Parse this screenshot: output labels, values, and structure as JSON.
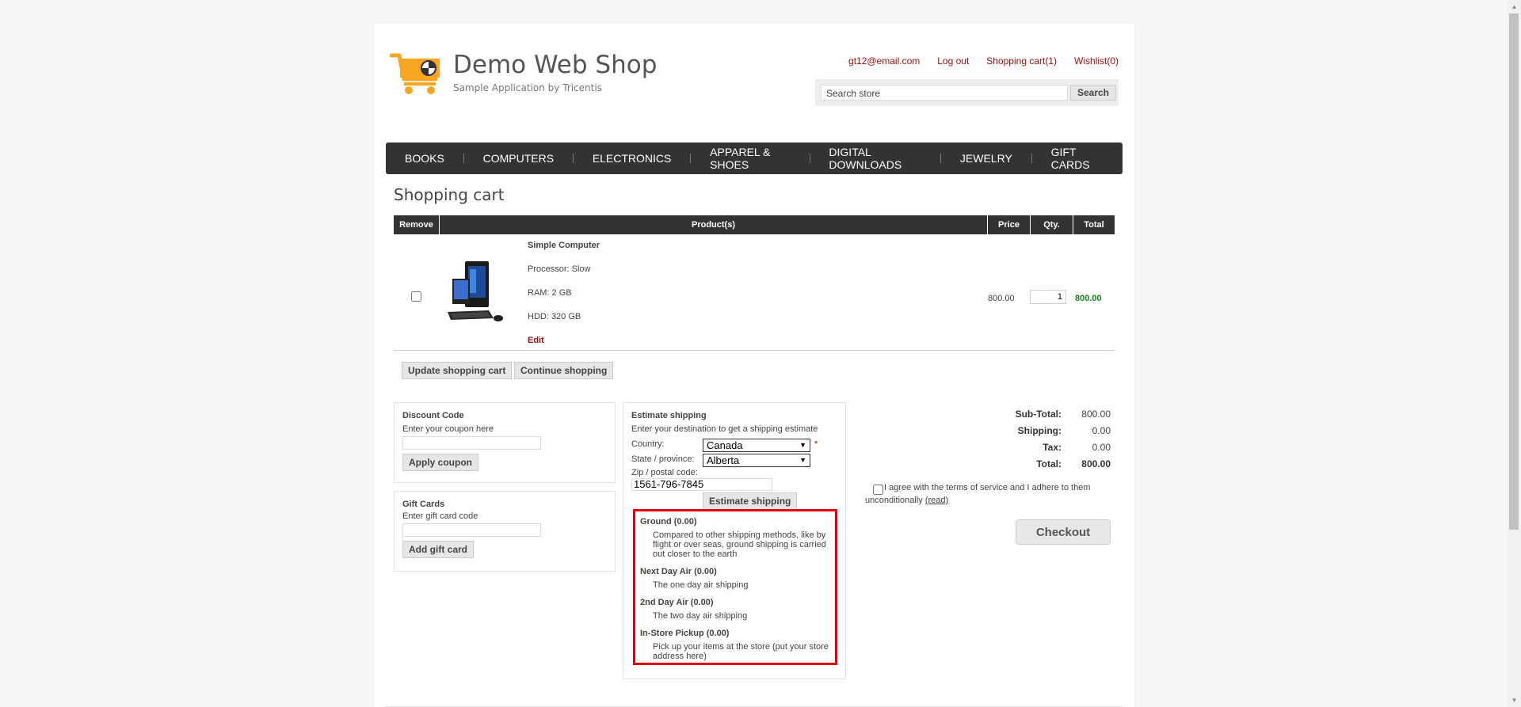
{
  "header": {
    "title": "Demo Web Shop",
    "subtitle": "Sample Application by Tricentis",
    "links": {
      "account": "gt12@email.com",
      "logout": "Log out",
      "cart": "Shopping cart(1)",
      "wishlist": "Wishlist(0)"
    },
    "search": {
      "value": "Search store",
      "button": "Search"
    }
  },
  "menu": [
    "BOOKS",
    "COMPUTERS",
    "ELECTRONICS",
    "APPAREL & SHOES",
    "DIGITAL DOWNLOADS",
    "JEWELRY",
    "GIFT CARDS"
  ],
  "page_title": "Shopping cart",
  "cart": {
    "columns": {
      "remove": "Remove",
      "product": "Product(s)",
      "price": "Price",
      "qty": "Qty.",
      "total": "Total"
    },
    "item": {
      "name": "Simple Computer",
      "attributes": [
        "Processor: Slow",
        "RAM: 2 GB",
        "HDD: 320 GB"
      ],
      "edit": "Edit",
      "price": "800.00",
      "qty": "1",
      "total": "800.00",
      "remove_checked": false
    },
    "buttons": {
      "update": "Update shopping cart",
      "continue": "Continue shopping"
    }
  },
  "discount": {
    "title": "Discount Code",
    "hint": "Enter your coupon here",
    "button": "Apply coupon"
  },
  "giftcard": {
    "title": "Gift Cards",
    "hint": "Enter gift card code",
    "button": "Add gift card"
  },
  "estimate": {
    "title": "Estimate shipping",
    "hint": "Enter your destination to get a shipping estimate",
    "country_label": "Country:",
    "country_value": "Canada",
    "state_label": "State / province:",
    "state_value": "Alberta",
    "zip_label": "Zip / postal code:",
    "zip_value": "1561-796-7845",
    "button": "Estimate shipping",
    "required_mark": "*",
    "options": [
      {
        "name": "Ground (0.00)",
        "desc": "Compared to other shipping methods, like by flight or over seas, ground shipping is carried out closer to the earth"
      },
      {
        "name": "Next Day Air (0.00)",
        "desc": "The one day air shipping"
      },
      {
        "name": "2nd Day Air (0.00)",
        "desc": "The two day air shipping"
      },
      {
        "name": "In-Store Pickup (0.00)",
        "desc": "Pick up your items at the store (put your store address here)"
      }
    ],
    "highlight_color": "#e4000f"
  },
  "totals": {
    "subtotal_label": "Sub-Total:",
    "subtotal": "800.00",
    "shipping_label": "Shipping:",
    "shipping": "0.00",
    "tax_label": "Tax:",
    "tax": "0.00",
    "total_label": "Total:",
    "total": "800.00"
  },
  "terms": {
    "text": "I agree with the terms of service and I adhere to them unconditionally",
    "read": "(read)"
  },
  "checkout": "Checkout",
  "colors": {
    "link": "#9e0b0f",
    "menu_bg": "#333333",
    "total_green": "#1d7f1d",
    "logo_orange": "#f7a523"
  }
}
